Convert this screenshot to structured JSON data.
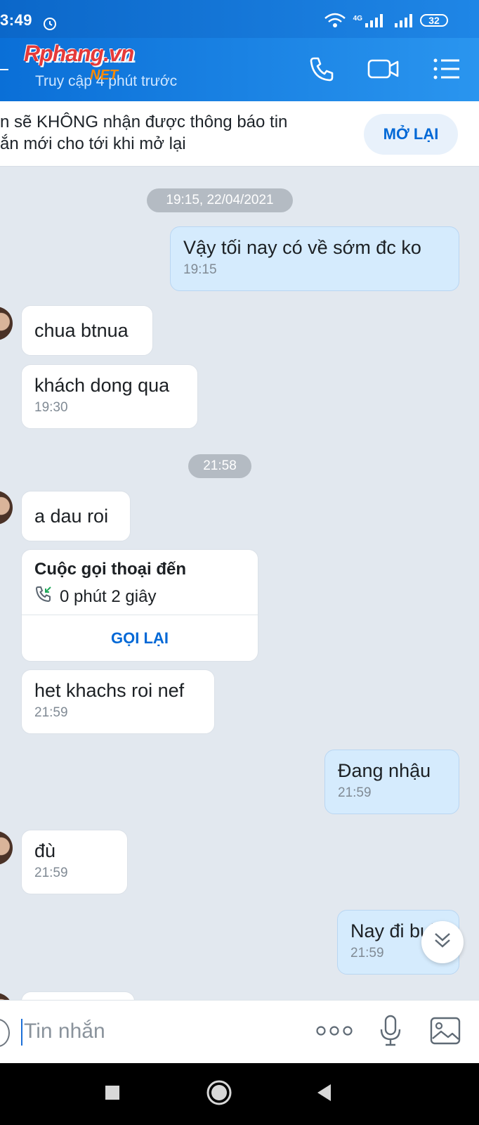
{
  "status_bar": {
    "time": "3:49",
    "network": "4G",
    "battery": "32"
  },
  "header": {
    "contact_name": "Trần N...32",
    "last_seen": "Truy cập 4 phút trước",
    "watermark": "Rphang.vn",
    "watermark_sub": "NET"
  },
  "notice": {
    "text_line1": "n sẽ KHÔNG nhận được thông báo tin",
    "text_line2": "ắn mới cho tới khi mở lại",
    "reopen_label": "MỞ LẠI"
  },
  "chat": {
    "date_pills": [
      "19:15, 22/04/2021",
      "21:58"
    ],
    "messages": [
      {
        "dir": "out",
        "text": "Vậy tối nay có về sớm đc ko",
        "time": "19:15"
      },
      {
        "dir": "in",
        "text": "chua btnua",
        "time": ""
      },
      {
        "dir": "in",
        "text": "khách dong qua",
        "time": "19:30"
      },
      {
        "dir": "in",
        "text": "a dau roi",
        "time": ""
      },
      {
        "dir": "in",
        "text": "het khachs roi nef",
        "time": "21:59"
      },
      {
        "dir": "out",
        "text": "Đang nhậu",
        "time": "21:59"
      },
      {
        "dir": "in",
        "text": "đù",
        "time": "21:59"
      },
      {
        "dir": "out",
        "text": "Nay đi bụi",
        "time": "21:59"
      }
    ],
    "call_card": {
      "title": "Cuộc gọi thoại đến",
      "duration": "0 phút 2 giây",
      "callback_label": "GỌI LẠI"
    }
  },
  "input": {
    "placeholder": "Tin nhắn",
    "value": ""
  },
  "colors": {
    "header_blue": "#1f86e6",
    "accent_blue": "#0068d6",
    "chat_bg": "#e2e8ef",
    "outgoing_bubble": "#d5ebfd",
    "incoming_bubble": "#ffffff"
  }
}
